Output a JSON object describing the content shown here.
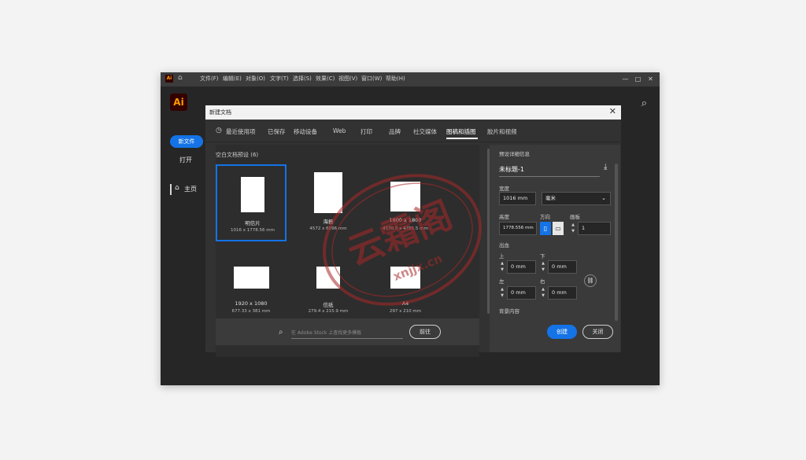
{
  "app": {
    "logo_text": "Ai",
    "menu": [
      "文件(F)",
      "编辑(E)",
      "对象(O)",
      "文字(T)",
      "选择(S)",
      "效果(C)",
      "视图(V)",
      "窗口(W)",
      "帮助(H)"
    ],
    "window_controls": [
      "—",
      "□",
      "✕"
    ],
    "new_file_label": "新文件",
    "open_label": "打开",
    "home_label": "主页"
  },
  "dialog": {
    "title": "新建文档",
    "close_label": "✕",
    "tabs": [
      "最近使用项",
      "已保存",
      "移动设备",
      "Web",
      "打印",
      "品牌",
      "社交媒体",
      "图稿和插图",
      "胶片和视频"
    ],
    "active_tab": "图稿和插图",
    "presets_heading": "空白文档预设 (6)",
    "presets": [
      {
        "name": "明信片",
        "size": "1016 x 1778.56 mm"
      },
      {
        "name": "海报",
        "size": "4572 x 6096 mm"
      },
      {
        "name": "1800 x 1800",
        "size": "4770.5 x 4765.5 mm"
      },
      {
        "name": "1920 x 1080",
        "size": "677.33 x 381 mm"
      },
      {
        "name": "信纸",
        "size": "279.4 x 215.9 mm"
      },
      {
        "name": "A4",
        "size": "297 x 210 mm"
      }
    ],
    "search_placeholder": "在 Adobe Stock 上查找更多模板",
    "go_label": "前往"
  },
  "details": {
    "heading": "预设详细信息",
    "doc_name": "未标题-1",
    "width_label": "宽度",
    "width_value": "1016 mm",
    "unit_value": "毫米",
    "height_label": "高度",
    "height_value": "1778.556 mm",
    "orientation_label": "方向",
    "artboards_label": "画板",
    "artboards_value": "1",
    "bleed_label": "出血",
    "top_label": "上",
    "bottom_label": "下",
    "left_label": "左",
    "right_label": "右",
    "top_value": "0 mm",
    "bottom_value": "0 mm",
    "left_value": "0 mm",
    "right_value": "0 mm",
    "advanced_label": "背景内容",
    "create_label": "创建",
    "close_label": "关闭"
  },
  "watermark": {
    "text": "云霜阁",
    "subtext": "xnjjx.cn",
    "color": "#a82828"
  },
  "icons": {
    "clock": "clock-icon",
    "search": "search-icon",
    "import": "import-icon",
    "link": "link-icon",
    "home": "home-icon"
  }
}
